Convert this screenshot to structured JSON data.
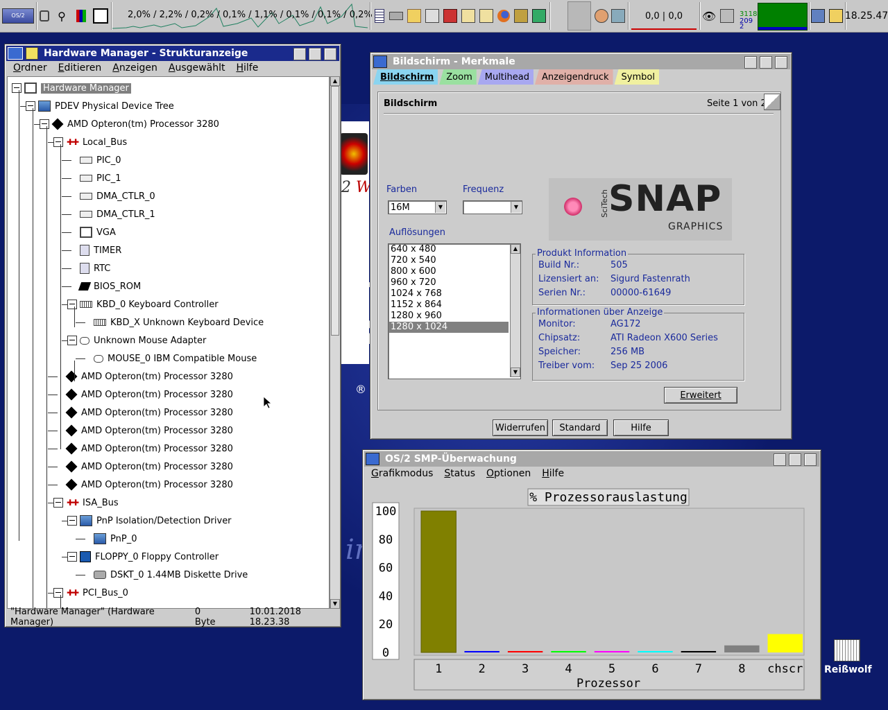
{
  "topbar": {
    "cpu_text": "2,0% / 2,2% / 0,2% / 0,1% / 1,1% / 0,1% / 0,1% / 0,2%",
    "net_text": "0,0 | 0,0",
    "counter_top": "3118",
    "counter_bottom": "209",
    "counter_extra": "2",
    "clock": "18.25.47",
    "accent_green": "#008000"
  },
  "hwman": {
    "title": "Hardware Manager - Strukturanzeige",
    "menu": [
      "Ordner",
      "Editieren",
      "Anzeigen",
      "Ausgewählt",
      "Hilfe"
    ],
    "tree": [
      {
        "label": "Hardware Manager",
        "icon": "monitor-icon",
        "selected": true
      },
      {
        "label": "PDEV Physical Device Tree",
        "icon": "computer-icon"
      },
      {
        "label": "AMD Opteron(tm) Processor 3280",
        "icon": "cpu-icon"
      },
      {
        "label": "Local_Bus",
        "icon": "bus-icon"
      },
      {
        "label": "PIC_0",
        "icon": "chip-icon"
      },
      {
        "label": "PIC_1",
        "icon": "chip-icon"
      },
      {
        "label": "DMA_CTLR_0",
        "icon": "chip-icon"
      },
      {
        "label": "DMA_CTLR_1",
        "icon": "chip-icon"
      },
      {
        "label": "VGA",
        "icon": "display-icon"
      },
      {
        "label": "TIMER",
        "icon": "clock-icon"
      },
      {
        "label": "RTC",
        "icon": "clock-icon"
      },
      {
        "label": "BIOS_ROM",
        "icon": "bios-icon"
      },
      {
        "label": "KBD_0 Keyboard Controller",
        "icon": "keyboard-icon"
      },
      {
        "label": "KBD_X Unknown Keyboard Device",
        "icon": "keyboard-icon"
      },
      {
        "label": "Unknown Mouse Adapter",
        "icon": "mouse-icon"
      },
      {
        "label": "MOUSE_0 IBM Compatible Mouse",
        "icon": "mouse-icon"
      },
      {
        "label": "AMD Opteron(tm) Processor 3280",
        "icon": "cpu-icon"
      },
      {
        "label": "AMD Opteron(tm) Processor 3280",
        "icon": "cpu-icon"
      },
      {
        "label": "AMD Opteron(tm) Processor 3280",
        "icon": "cpu-icon"
      },
      {
        "label": "AMD Opteron(tm) Processor 3280",
        "icon": "cpu-icon"
      },
      {
        "label": "AMD Opteron(tm) Processor 3280",
        "icon": "cpu-icon"
      },
      {
        "label": "AMD Opteron(tm) Processor 3280",
        "icon": "cpu-icon"
      },
      {
        "label": "AMD Opteron(tm) Processor 3280",
        "icon": "cpu-icon"
      },
      {
        "label": "ISA_Bus",
        "icon": "bus-icon"
      },
      {
        "label": "PnP Isolation/Detection Driver",
        "icon": "computer-icon"
      },
      {
        "label": "PnP_0",
        "icon": "computer-icon"
      },
      {
        "label": "FLOPPY_0 Floppy Controller",
        "icon": "floppy-icon"
      },
      {
        "label": "DSKT_0 1.44MB Diskette Drive",
        "icon": "disk-icon"
      },
      {
        "label": "PCI_Bus_0",
        "icon": "bus-icon"
      }
    ],
    "status_name": "\"Hardware Manager\" (Hardware Manager)",
    "status_size": "0 Byte",
    "status_date": "10.01.2018 18.23.38"
  },
  "screen": {
    "title": "Bildschirm - Merkmale",
    "tabs": [
      {
        "label": "Bildschirm",
        "color": "#8ad4f0"
      },
      {
        "label": "Zoom",
        "color": "#9ae0a0"
      },
      {
        "label": "Multihead",
        "color": "#a8a8f0"
      },
      {
        "label": "Anzeigendruck",
        "color": "#e0b0a8"
      },
      {
        "label": "Symbol",
        "color": "#f0f0a0"
      }
    ],
    "page_title": "Bildschirm",
    "page_count": "Seite 1 von 2",
    "farben_label": "Farben",
    "farben_value": "16M",
    "frequenz_label": "Frequenz",
    "frequenz_value": "",
    "aufl_label": "Auflösungen",
    "resolutions": [
      "640 x 480",
      "720 x 540",
      "800 x 600",
      "960 x 720",
      "1024 x 768",
      "1152 x 864",
      "1280 x 960",
      "1280 x 1024"
    ],
    "selected_resolution": "1280 x 1024",
    "logo_brand": "SNAP",
    "logo_sub": "GRAPHICS",
    "logo_maker": "SciTech",
    "produkt_legend": "Produkt Information",
    "produkt": [
      {
        "key": "Build Nr.:",
        "value": "505"
      },
      {
        "key": "Lizensiert an:",
        "value": "Sigurd Fastenrath"
      },
      {
        "key": "Serien Nr.:",
        "value": "00000-61649"
      }
    ],
    "anzeige_legend": "Informationen über Anzeige",
    "anzeige": [
      {
        "key": "Monitor:",
        "value": "AG172"
      },
      {
        "key": "Chipsatz:",
        "value": "ATI Radeon X600 Series"
      },
      {
        "key": "Speicher:",
        "value": "256 MB"
      },
      {
        "key": "Treiber vom:",
        "value": "Sep 25 2006"
      }
    ],
    "erweitert": "Erweitert",
    "widerrufen": "Widerrufen",
    "standard": "Standard",
    "hilfe": "Hilfe"
  },
  "smp": {
    "title": "OS/2 SMP-Überwachung",
    "menu": [
      "Grafikmodus",
      "Status",
      "Optionen",
      "Hilfe"
    ],
    "desktop_icon_label": "Reißwolf"
  },
  "chart_data": {
    "type": "bar",
    "title": "% Prozessorauslastung",
    "xlabel": "Prozessor",
    "ylabel": "",
    "categories": [
      "1",
      "2",
      "3",
      "4",
      "5",
      "6",
      "7",
      "8",
      "chscr"
    ],
    "values": [
      100,
      1,
      1,
      1,
      1,
      1,
      1,
      5,
      13
    ],
    "colors": [
      "#808000",
      "#0000ff",
      "#ff0000",
      "#00ff00",
      "#ff00ff",
      "#00ffff",
      "#000000",
      "#808080",
      "#ffff00"
    ],
    "yticks": [
      "100",
      "80",
      "60",
      "40",
      "20",
      "0"
    ],
    "ylim": [
      0,
      100
    ],
    "grid": false
  }
}
